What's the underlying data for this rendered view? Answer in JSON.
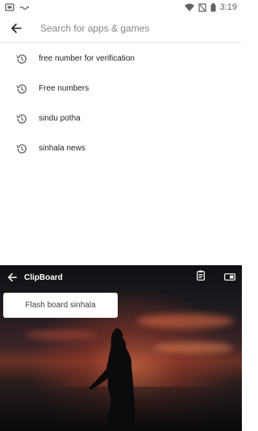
{
  "status_bar": {
    "time": "3:19",
    "icons": [
      "screen-record-icon",
      "signal-icon",
      "wifi-icon",
      "no-sim-icon",
      "battery-icon"
    ]
  },
  "search": {
    "placeholder": "Search for apps & games",
    "value": ""
  },
  "suggestions": [
    {
      "label": "free number for verification",
      "icon": "history-icon"
    },
    {
      "label": "Free numbers",
      "icon": "history-icon"
    },
    {
      "label": "sindu potha",
      "icon": "history-icon"
    },
    {
      "label": "sinhala news",
      "icon": "history-icon"
    }
  ],
  "keyboard": {
    "title": "ClipBoard",
    "clip_items": [
      "Flash board sinhala"
    ]
  },
  "colors": {
    "accent": "#ffffff",
    "text": "#202124",
    "icon": "#5f6368"
  }
}
